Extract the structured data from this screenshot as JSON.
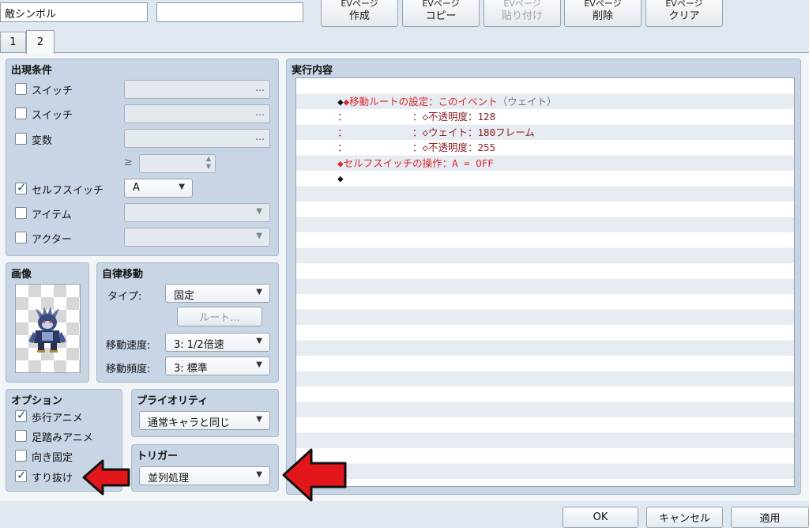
{
  "header": {
    "event_name": "敵シンボル",
    "note_value": ""
  },
  "page_buttons": [
    {
      "top": "EVページ",
      "label": "作成",
      "enabled": true
    },
    {
      "top": "EVページ",
      "label": "コピー",
      "enabled": true
    },
    {
      "top": "EVページ",
      "label": "貼り付け",
      "enabled": false
    },
    {
      "top": "EVページ",
      "label": "削除",
      "enabled": true
    },
    {
      "top": "EVページ",
      "label": "クリア",
      "enabled": true
    }
  ],
  "tabs": [
    {
      "label": "1",
      "active": false
    },
    {
      "label": "2",
      "active": true
    }
  ],
  "conditions": {
    "title": "出現条件",
    "switch1": {
      "label": "スイッチ",
      "checked": false,
      "dots": "…"
    },
    "switch2": {
      "label": "スイッチ",
      "checked": false,
      "dots": "…"
    },
    "variable": {
      "label": "変数",
      "checked": false,
      "dots": "…"
    },
    "ge_symbol": "≥",
    "self_switch": {
      "label": "セルフスイッチ",
      "checked": true,
      "value": "A"
    },
    "item": {
      "label": "アイテム",
      "checked": false,
      "value": ""
    },
    "actor": {
      "label": "アクター",
      "checked": false,
      "value": ""
    }
  },
  "image": {
    "title": "画像"
  },
  "autonomous": {
    "title": "自律移動",
    "type_label": "タイプ:",
    "type_value": "固定",
    "route_button": "ルート...",
    "speed_label": "移動速度:",
    "speed_value": "3: 1/2倍速",
    "freq_label": "移動頻度:",
    "freq_value": "3: 標準"
  },
  "options": {
    "title": "オプション",
    "items": [
      {
        "label": "歩行アニメ",
        "checked": true
      },
      {
        "label": "足踏みアニメ",
        "checked": false
      },
      {
        "label": "向き固定",
        "checked": false
      },
      {
        "label": "すり抜け",
        "checked": true
      }
    ]
  },
  "priority": {
    "title": "プライオリティ",
    "value": "通常キャラと同じ"
  },
  "trigger": {
    "title": "トリガー",
    "value": "並列処理"
  },
  "contents": {
    "title": "実行内容",
    "lines": [
      {
        "a": "◆移動ルートの設定：このイベント",
        "b": "（ウェイト）"
      },
      {
        "a": "：",
        "b": "：◇不透明度：128"
      },
      {
        "a": "：",
        "b": "：◇ウェイト：180フレーム"
      },
      {
        "a": "：",
        "b": "：◇不透明度：255"
      },
      {
        "a": "◆セルフスイッチの操作：A = OFF",
        "b": ""
      },
      {
        "a": "◆",
        "b": ""
      }
    ]
  },
  "footer": {
    "ok": "OK",
    "cancel": "キャンセル",
    "apply": "適用"
  },
  "colors": {
    "arrow": "#e3161b",
    "panel": "#c7d5e4",
    "command_text": "#b21f22"
  }
}
